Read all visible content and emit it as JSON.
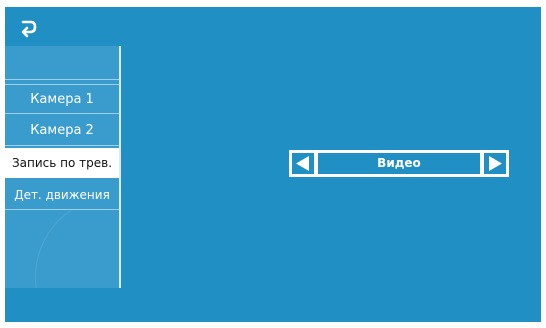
{
  "header": {
    "back_icon": "back-arrow-icon"
  },
  "sidebar": {
    "items": [
      {
        "label": ""
      },
      {
        "label": "Камера 1"
      },
      {
        "label": "Камера 2"
      },
      {
        "label": "Запись по трев.",
        "selected": true
      },
      {
        "label": "Дет. движения"
      }
    ]
  },
  "setting": {
    "value": "Видео",
    "prev_icon": "triangle-left-icon",
    "next_icon": "triangle-right-icon"
  },
  "colors": {
    "background": "#1f8fc4",
    "panel": "#3a9ccd",
    "selected_item": "#ffffff",
    "text": "#ffffff"
  }
}
